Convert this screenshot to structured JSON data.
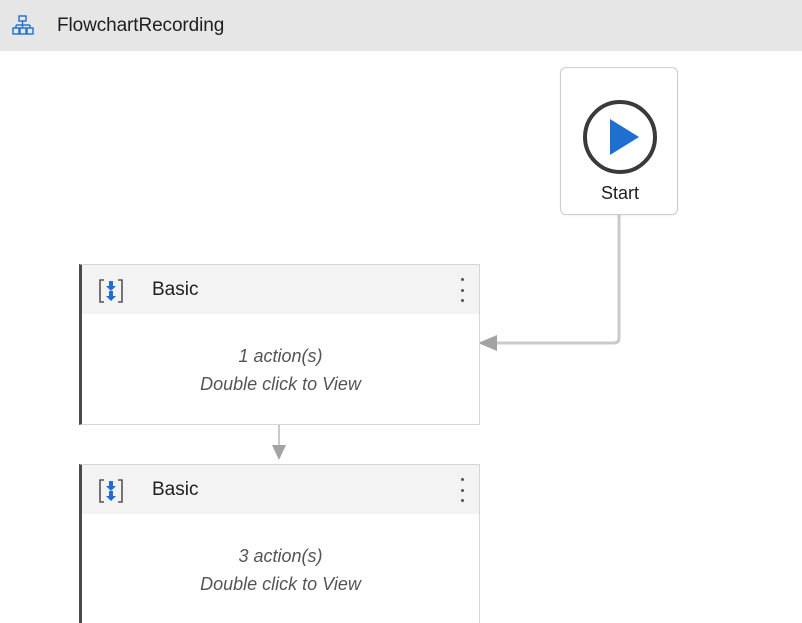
{
  "header": {
    "title": "FlowchartRecording",
    "icon": "flowchart-icon"
  },
  "start_node": {
    "label": "Start",
    "icon": "play-circle-icon",
    "accent": "#1f6fd1"
  },
  "sequences": [
    {
      "title": "Basic",
      "icon": "sequence-icon",
      "actions": "1 action(s)",
      "hint": "Double click to View"
    },
    {
      "title": "Basic",
      "icon": "sequence-icon",
      "actions": "3 action(s)",
      "hint": "Double click to View"
    }
  ],
  "colors": {
    "header_bg": "#e6e6e6",
    "card_border": "#d4d8dc",
    "connector": "#c0c4c8",
    "arrow": "#9a9a9a",
    "icon_blue": "#1f6fd1"
  }
}
